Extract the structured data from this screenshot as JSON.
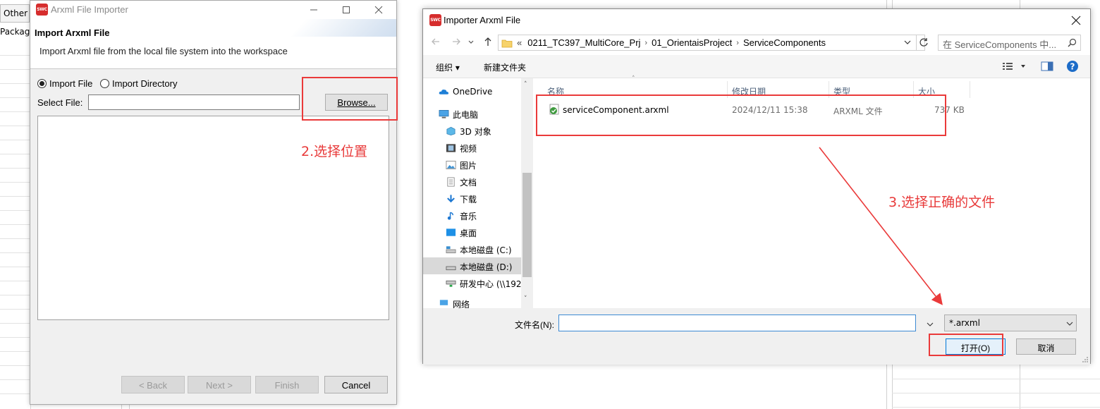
{
  "background": {
    "tab_label": "Other",
    "side_label": "Package"
  },
  "wizard": {
    "window_title": "Arxml File Importer",
    "logo_text": "SWC",
    "header_title": "Import Arxml File",
    "header_desc": "Import Arxml file from the local file system into the workspace",
    "radio_file": "Import File",
    "radio_dir": "Import Directory",
    "select_label": "Select File:",
    "select_value": "",
    "browse": "Browse...",
    "back": "< Back",
    "next": "Next >",
    "finish": "Finish",
    "cancel": "Cancel"
  },
  "annotations": {
    "step2": "2.选择位置",
    "step3": "3.选择正确的文件"
  },
  "dialog": {
    "title": "Importer Arxml File",
    "breadcrumb": [
      "«",
      "0211_TC397_MultiCore_Prj",
      "01_OrientaisProject",
      "ServiceComponents"
    ],
    "search_placeholder": "在 ServiceComponents 中...",
    "toolbar": {
      "organize": "组织 ▾",
      "new_folder": "新建文件夹"
    },
    "columns": {
      "name": "名称",
      "date": "修改日期",
      "type": "类型",
      "size": "大小"
    },
    "nav_items": [
      {
        "label": "OneDrive",
        "icon": "onedrive-icon"
      },
      {
        "label": "此电脑",
        "icon": "computer-icon"
      },
      {
        "label": "3D 对象",
        "icon": "3d-objects-icon"
      },
      {
        "label": "视频",
        "icon": "video-icon"
      },
      {
        "label": "图片",
        "icon": "pictures-icon"
      },
      {
        "label": "文档",
        "icon": "documents-icon"
      },
      {
        "label": "下载",
        "icon": "download-icon"
      },
      {
        "label": "音乐",
        "icon": "music-icon"
      },
      {
        "label": "桌面",
        "icon": "desktop-icon"
      },
      {
        "label": "本地磁盘 (C:)",
        "icon": "drive-icon"
      },
      {
        "label": "本地磁盘 (D:)",
        "icon": "drive-icon"
      },
      {
        "label": "研发中心 (\\\\192",
        "icon": "network-drive-icon"
      },
      {
        "label": "网络",
        "icon": "network-icon"
      }
    ],
    "selected_nav": "本地磁盘 (D:)",
    "file": {
      "name": "serviceComponent.arxml",
      "date": "2024/12/11 15:38",
      "type": "ARXML 文件",
      "size": "737 KB"
    },
    "filename_label": "文件名(N):",
    "filename_value": "",
    "filter_value": "*.arxml",
    "open_button": "打开(O)",
    "cancel_button": "取消"
  },
  "colors": {
    "accent_red": "#ea3a3a",
    "logo_red": "#d62d2d",
    "link_blue": "#0067c0"
  }
}
